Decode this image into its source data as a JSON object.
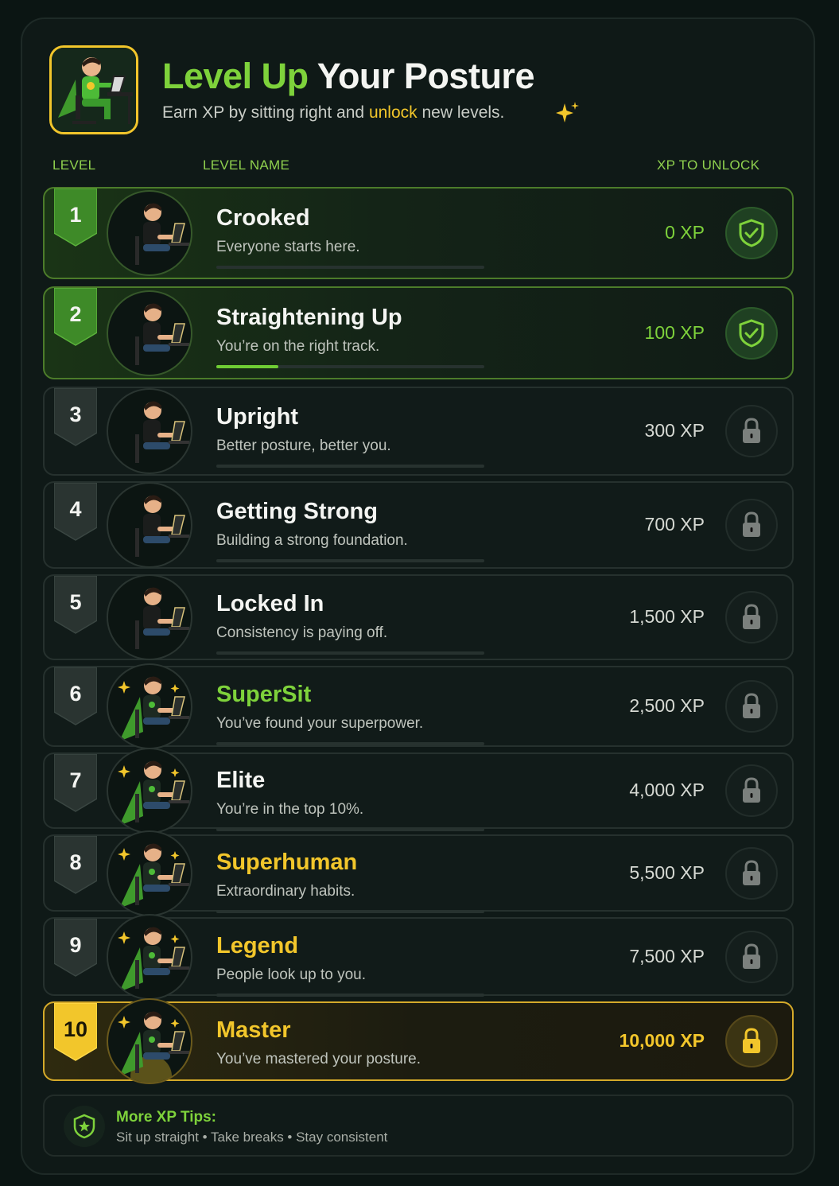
{
  "header": {
    "title_part1": "Level Up",
    "title_part2": "Your Posture",
    "subtitle_before": "Earn XP by sitting right and",
    "subtitle_highlight": "unlock",
    "subtitle_after": "new levels."
  },
  "columns": {
    "level": "LEVEL",
    "level_name": "LEVEL NAME",
    "xp": "XP TO UNLOCK"
  },
  "levels": [
    {
      "num": "1",
      "name": "Crooked",
      "desc": "Everyone starts here.",
      "xp": "0 XP",
      "status": "unlocked",
      "name_color": "white",
      "xp_color": "green",
      "progress": 0
    },
    {
      "num": "2",
      "name": "Straightening Up",
      "desc": "You’re on the right track.",
      "xp": "100 XP",
      "status": "unlocked",
      "name_color": "white",
      "xp_color": "green",
      "progress": 0.23
    },
    {
      "num": "3",
      "name": "Upright",
      "desc": "Better posture, better you.",
      "xp": "300 XP",
      "status": "locked",
      "name_color": "white",
      "xp_color": "gray",
      "progress": 0
    },
    {
      "num": "4",
      "name": "Getting Strong",
      "desc": "Building a strong foundation.",
      "xp": "700 XP",
      "status": "locked",
      "name_color": "white",
      "xp_color": "gray",
      "progress": 0
    },
    {
      "num": "5",
      "name": "Locked In",
      "desc": "Consistency is paying off.",
      "xp": "1,500 XP",
      "status": "locked",
      "name_color": "white",
      "xp_color": "gray",
      "progress": 0
    },
    {
      "num": "6",
      "name": "SuperSit",
      "desc": "You’ve found your superpower.",
      "xp": "2,500 XP",
      "status": "locked",
      "name_color": "green",
      "xp_color": "gray",
      "progress": 0
    },
    {
      "num": "7",
      "name": "Elite",
      "desc": "You’re in the top 10%.",
      "xp": "4,000 XP",
      "status": "locked",
      "name_color": "white",
      "xp_color": "gray",
      "progress": 0
    },
    {
      "num": "8",
      "name": "Superhuman",
      "desc": "Extraordinary habits.",
      "xp": "5,500 XP",
      "status": "locked",
      "name_color": "yellow",
      "xp_color": "gray",
      "progress": 0
    },
    {
      "num": "9",
      "name": "Legend",
      "desc": "People look up to you.",
      "xp": "7,500 XP",
      "status": "locked",
      "name_color": "yellow",
      "xp_color": "gray",
      "progress": 0
    },
    {
      "num": "10",
      "name": "Master",
      "desc": "You’ve mastered your posture.",
      "xp": "10,000 XP",
      "status": "gold-locked",
      "name_color": "yellow",
      "xp_color": "yellow",
      "progress": 0
    }
  ],
  "tips": {
    "title": "More XP Tips:",
    "text": "Sit up straight • Take breaks • Stay consistent"
  },
  "colors": {
    "accent_green": "#7ed23b",
    "accent_yellow": "#f2c62b",
    "background": "#0b1513"
  }
}
